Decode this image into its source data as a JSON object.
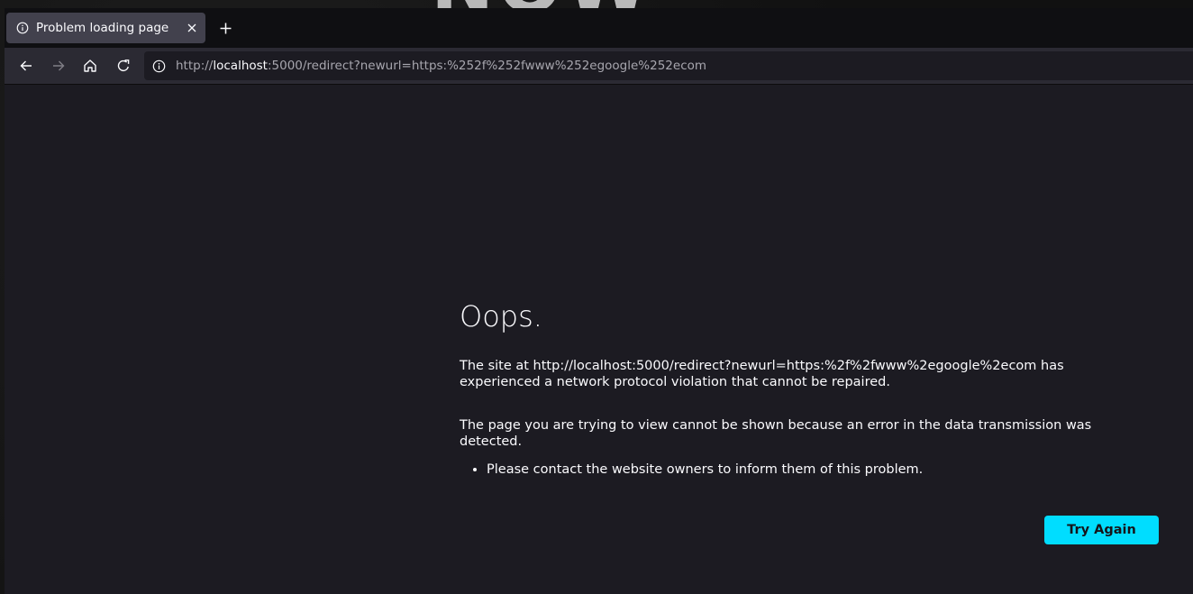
{
  "tab": {
    "title": "Problem loading page",
    "icon": "info-icon",
    "close_icon": "close-icon"
  },
  "toolbar": {
    "new_tab_icon": "plus-icon",
    "back_icon": "arrow-left-icon",
    "forward_icon": "arrow-right-icon",
    "home_icon": "home-icon",
    "reload_icon": "reload-icon"
  },
  "urlbar": {
    "icon": "info-icon",
    "scheme": "http://",
    "host": "localhost",
    "rest": ":5000/redirect?newurl=https:%252f%252fwww%252egoogle%252ecom"
  },
  "error": {
    "title": "Oops.",
    "paragraph1": "The site at http://localhost:5000/redirect?newurl=https:%2f%2fwww%2egoogle%2ecom has experienced a network protocol violation that cannot be repaired.",
    "paragraph2": "The page you are trying to view cannot be shown because an error in the data transmission was detected.",
    "list": [
      "Please contact the website owners to inform them of this problem."
    ],
    "button_label": "Try Again",
    "button_color": "#00ddff"
  },
  "background_text": "NOW"
}
